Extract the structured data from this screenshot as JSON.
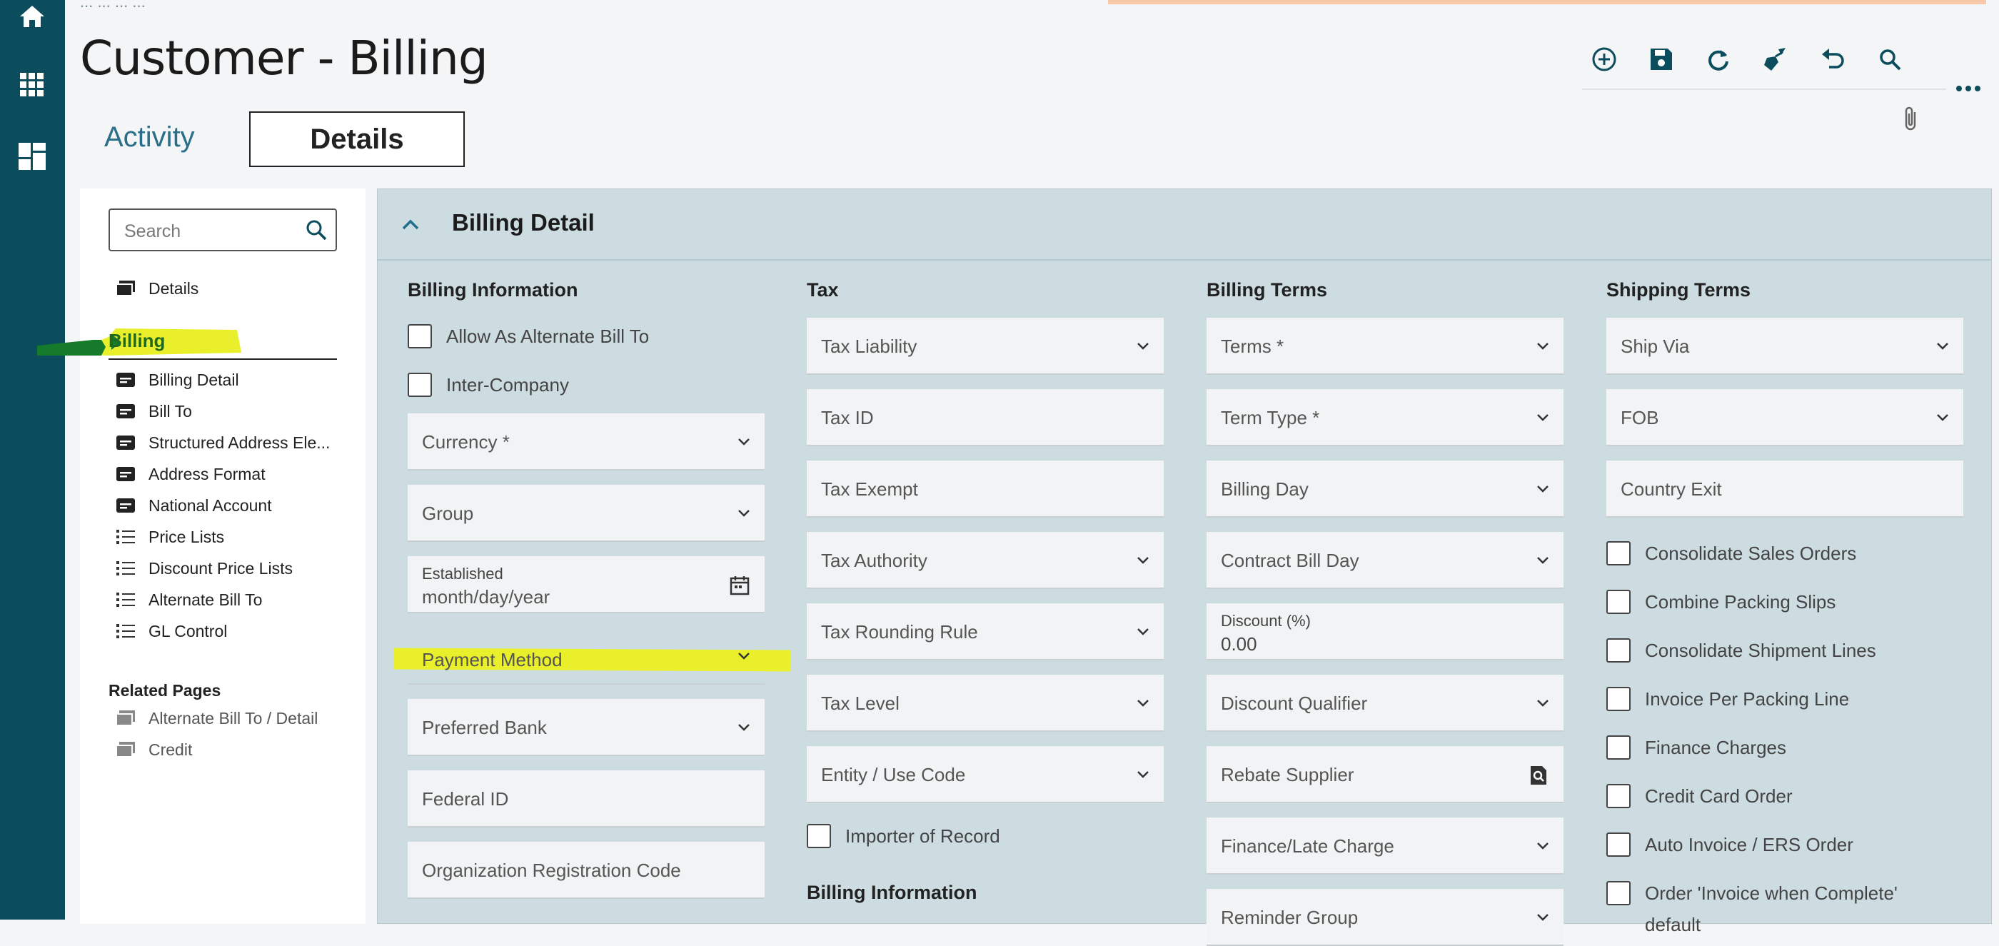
{
  "header": {
    "breadcrumb": "... ... ... ...",
    "title": "Customer - Billing",
    "tabs": [
      {
        "label": "Activity"
      },
      {
        "label": "Details"
      }
    ]
  },
  "toolbar": {
    "icons": [
      "add-icon",
      "save-icon",
      "refresh-icon",
      "clear-icon",
      "undo-icon",
      "search-icon"
    ],
    "more": "..."
  },
  "nav": {
    "search_placeholder": "Search",
    "details_label": "Details",
    "billing_label": "Billing",
    "items": [
      {
        "label": "Billing Detail",
        "icon": "card-icon"
      },
      {
        "label": "Bill To",
        "icon": "card-icon"
      },
      {
        "label": "Structured Address Ele...",
        "icon": "card-icon"
      },
      {
        "label": "Address Format",
        "icon": "card-icon"
      },
      {
        "label": "National Account",
        "icon": "card-icon"
      },
      {
        "label": "Price Lists",
        "icon": "list-icon"
      },
      {
        "label": "Discount Price Lists",
        "icon": "list-icon"
      },
      {
        "label": "Alternate Bill To",
        "icon": "list-icon"
      },
      {
        "label": "GL Control",
        "icon": "list-icon"
      }
    ],
    "related_title": "Related Pages",
    "related": [
      {
        "label": "Alternate Bill To / Detail"
      },
      {
        "label": "Credit"
      }
    ]
  },
  "main": {
    "section_title": "Billing Detail",
    "columns": {
      "billing_info": {
        "title": "Billing Information",
        "checkboxes": [
          "Allow As Alternate Bill To",
          "Inter-Company"
        ],
        "fields": [
          "Currency *",
          "Group"
        ],
        "established_label": "Established",
        "established_placeholder": "month/day/year",
        "fields2": [
          "Payment Method",
          "Preferred Bank",
          "Federal ID",
          "Organization Registration Code"
        ]
      },
      "tax": {
        "title": "Tax",
        "fields": [
          "Tax Liability",
          "Tax ID",
          "Tax Exempt",
          "Tax Authority",
          "Tax Rounding Rule",
          "Tax Level",
          "Entity / Use Code"
        ],
        "checkbox": "Importer of Record",
        "sub_title": "Billing Information"
      },
      "billing_terms": {
        "title": "Billing Terms",
        "fields": [
          "Terms *",
          "Term Type *",
          "Billing Day",
          "Contract Bill Day"
        ],
        "discount_label": "Discount (%)",
        "discount_value": "0.00",
        "fields2": [
          "Discount Qualifier",
          "Rebate Supplier",
          "Finance/Late Charge",
          "Reminder Group"
        ]
      },
      "shipping_terms": {
        "title": "Shipping Terms",
        "fields": [
          "Ship Via",
          "FOB",
          "Country Exit"
        ],
        "checkboxes": [
          "Consolidate Sales Orders",
          "Combine Packing Slips",
          "Consolidate Shipment Lines",
          "Invoice Per Packing Line",
          "Finance Charges",
          "Credit Card Order",
          "Auto Invoice / ERS Order",
          "Order 'Invoice when Complete'"
        ],
        "checkbox_tail": "default"
      }
    }
  },
  "colors": {
    "rail": "#0b4d5c",
    "accent": "#2a6f8a",
    "panel": "#ccdce1",
    "highlight_yellow": "#e9ef2a",
    "highlight_green": "#1f6a1f"
  }
}
